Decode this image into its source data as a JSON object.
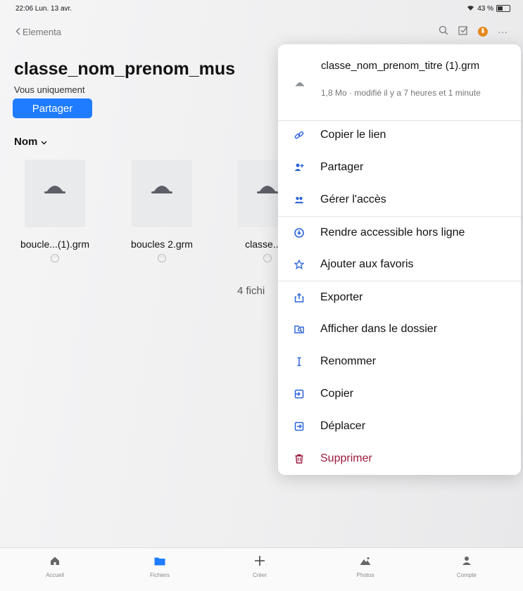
{
  "status": {
    "time": "22:06  Lun. 13 avr.",
    "battery": "43 %"
  },
  "nav": {
    "back_label": "Elementa"
  },
  "folder": {
    "title": "classe_nom_prenom_mus",
    "subtitle": "Vous uniquement",
    "share_label": "Partager",
    "sort_label": "Nom"
  },
  "files": [
    {
      "name": "boucle...(1).grm"
    },
    {
      "name": "boucles 2.grm"
    },
    {
      "name": "classe...(1"
    }
  ],
  "file_count": "4 fichi",
  "menu": {
    "file_title": "classe_nom_prenom_titre (1).grm",
    "file_meta": "1,8 Mo · modifié il y a 7 heures et 1 minute",
    "items": [
      {
        "label": "Copier le lien",
        "icon": "link-icon"
      },
      {
        "label": "Partager",
        "icon": "add-person-icon"
      },
      {
        "label": "Gérer l'accès",
        "icon": "people-icon"
      },
      {
        "label": "Rendre accessible hors ligne",
        "icon": "offline-icon"
      },
      {
        "label": "Ajouter aux favoris",
        "icon": "star-icon"
      },
      {
        "label": "Exporter",
        "icon": "export-icon"
      },
      {
        "label": "Afficher dans le dossier",
        "icon": "folder-search-icon"
      },
      {
        "label": "Renommer",
        "icon": "rename-icon"
      },
      {
        "label": "Copier",
        "icon": "copy-icon"
      },
      {
        "label": "Déplacer",
        "icon": "move-icon"
      },
      {
        "label": "Supprimer",
        "icon": "trash-icon"
      }
    ]
  },
  "tabs": [
    {
      "label": "Accueil",
      "icon": "home-icon"
    },
    {
      "label": "Fichiers",
      "icon": "folder-icon"
    },
    {
      "label": "Créer",
      "icon": "plus-icon"
    },
    {
      "label": "Photos",
      "icon": "photos-icon"
    },
    {
      "label": "Compte",
      "icon": "account-icon"
    }
  ],
  "colors": {
    "accent": "#1f7cff",
    "danger": "#9c1a3b",
    "menu_icon": "#2b63d9"
  }
}
